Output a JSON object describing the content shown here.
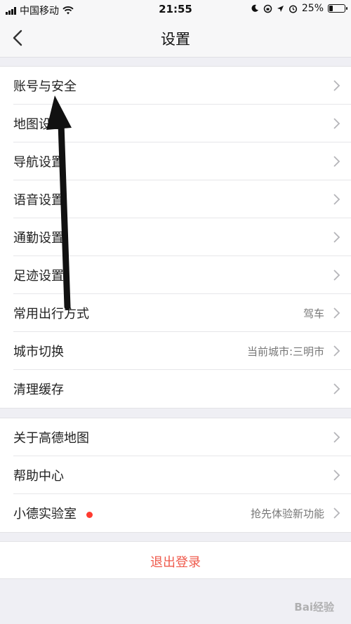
{
  "status_bar": {
    "carrier": "中国移动",
    "time": "21:55",
    "battery_text": "25%",
    "battery_level": 0.25
  },
  "nav": {
    "title": "设置"
  },
  "group1": [
    {
      "label": "账号与安全",
      "value": ""
    },
    {
      "label": "地图设置",
      "value": ""
    },
    {
      "label": "导航设置",
      "value": ""
    },
    {
      "label": "语音设置",
      "value": ""
    },
    {
      "label": "通勤设置",
      "value": ""
    },
    {
      "label": "足迹设置",
      "value": ""
    },
    {
      "label": "常用出行方式",
      "value": "驾车"
    },
    {
      "label": "城市切换",
      "value": "当前城市:三明市"
    },
    {
      "label": "清理缓存",
      "value": ""
    }
  ],
  "group2": [
    {
      "label": "关于高德地图",
      "value": ""
    },
    {
      "label": "帮助中心",
      "value": ""
    },
    {
      "label": "小德实验室",
      "value": "抢先体验新功能"
    }
  ],
  "logout": {
    "label": "退出登录"
  },
  "watermark": {
    "text": "Bai经验"
  },
  "colors": {
    "logout_red": "#ef5a4c",
    "dot_red": "#ff3b30",
    "background": "#efeff4"
  }
}
